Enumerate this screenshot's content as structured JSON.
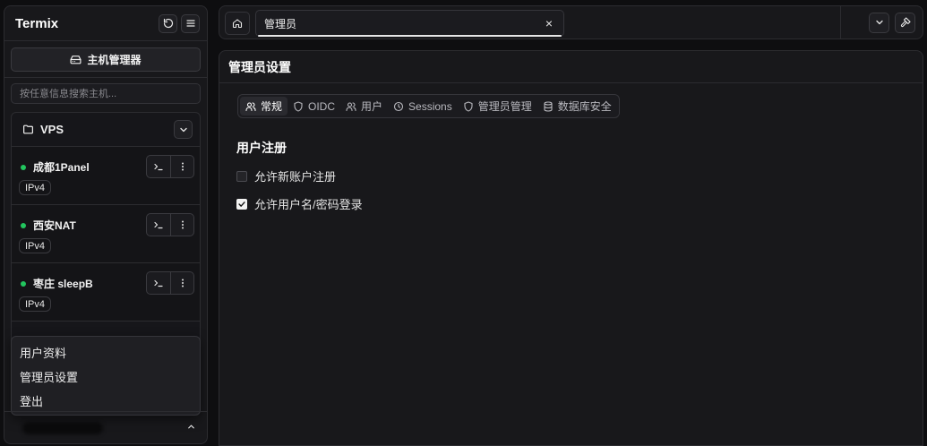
{
  "app": {
    "title": "Termix"
  },
  "sidebar": {
    "host_manager_label": "主机管理器",
    "search_placeholder": "按任意信息搜索主机...",
    "folder": {
      "name": "VPS",
      "hosts": [
        {
          "name": "成都1Panel",
          "badge": "IPv4",
          "status_color": "#22c55e"
        },
        {
          "name": "西安NAT",
          "badge": "IPv4",
          "status_color": "#22c55e"
        },
        {
          "name": "枣庄 sleepB",
          "badge": "IPv4",
          "status_color": "#22c55e"
        }
      ]
    },
    "user_menu": [
      "用户资料",
      "管理员设置",
      "登出"
    ]
  },
  "topbar": {
    "tab_label": "管理员",
    "close_glyph": "×"
  },
  "main": {
    "title": "管理员设置",
    "tabs": [
      {
        "label": "常规",
        "icon": "users-icon",
        "active": true
      },
      {
        "label": "OIDC",
        "icon": "shield-icon",
        "active": false
      },
      {
        "label": "用户",
        "icon": "users-icon",
        "active": false
      },
      {
        "label": "Sessions",
        "icon": "clock-icon",
        "active": false
      },
      {
        "label": "管理员管理",
        "icon": "shield-icon",
        "active": false
      },
      {
        "label": "数据库安全",
        "icon": "database-icon",
        "active": false
      }
    ],
    "section_title": "用户注册",
    "options": [
      {
        "label": "允许新账户注册",
        "checked": false
      },
      {
        "label": "允许用户名/密码登录",
        "checked": true
      }
    ]
  },
  "colors": {
    "accent_status": "#22c55e",
    "background": "#0e0e10",
    "panel": "#18181b"
  }
}
